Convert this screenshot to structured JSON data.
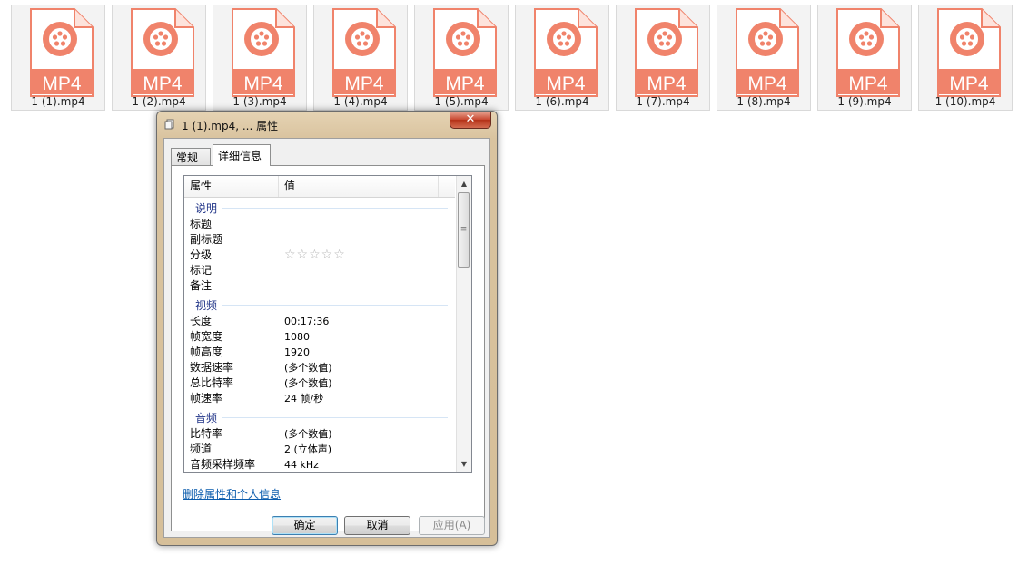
{
  "files": [
    {
      "label": "1 (1).mp4",
      "badge": "MP4"
    },
    {
      "label": "1 (2).mp4",
      "badge": "MP4"
    },
    {
      "label": "1 (3).mp4",
      "badge": "MP4"
    },
    {
      "label": "1 (4).mp4",
      "badge": "MP4"
    },
    {
      "label": "1 (5).mp4",
      "badge": "MP4"
    },
    {
      "label": "1 (6).mp4",
      "badge": "MP4"
    },
    {
      "label": "1 (7).mp4",
      "badge": "MP4"
    },
    {
      "label": "1 (8).mp4",
      "badge": "MP4"
    },
    {
      "label": "1 (9).mp4",
      "badge": "MP4"
    },
    {
      "label": "1 (10).mp4",
      "badge": "MP4"
    }
  ],
  "colors": {
    "file_accent": "#f0836b",
    "section_title": "#1e3287",
    "link": "#0b5cad"
  },
  "dialog": {
    "title": "1 (1).mp4, ... 属性",
    "close_label": "✕",
    "tabs": {
      "general": "常规",
      "details": "详细信息"
    },
    "columns": {
      "property": "属性",
      "value": "值"
    },
    "sections": {
      "description": {
        "title": "说明",
        "rows": [
          {
            "p": "标题",
            "v": ""
          },
          {
            "p": "副标题",
            "v": ""
          },
          {
            "p": "分级",
            "v": ""
          },
          {
            "p": "标记",
            "v": ""
          },
          {
            "p": "备注",
            "v": ""
          }
        ]
      },
      "video": {
        "title": "视频",
        "rows": [
          {
            "p": "长度",
            "v": "00:17:36"
          },
          {
            "p": "帧宽度",
            "v": "1080"
          },
          {
            "p": "帧高度",
            "v": "1920"
          },
          {
            "p": "数据速率",
            "v": "(多个数值)"
          },
          {
            "p": "总比特率",
            "v": "(多个数值)"
          },
          {
            "p": "帧速率",
            "v": "24 帧/秒"
          }
        ]
      },
      "audio": {
        "title": "音频",
        "rows": [
          {
            "p": "比特率",
            "v": "(多个数值)"
          },
          {
            "p": "频道",
            "v": "2 (立体声)"
          },
          {
            "p": "音频采样频率",
            "v": "44 kHz"
          }
        ]
      }
    },
    "rating_stars": "☆☆☆☆☆",
    "rating_value": 0,
    "remove_link": "删除属性和个人信息",
    "buttons": {
      "ok": "确定",
      "cancel": "取消",
      "apply": "应用(A)"
    }
  }
}
